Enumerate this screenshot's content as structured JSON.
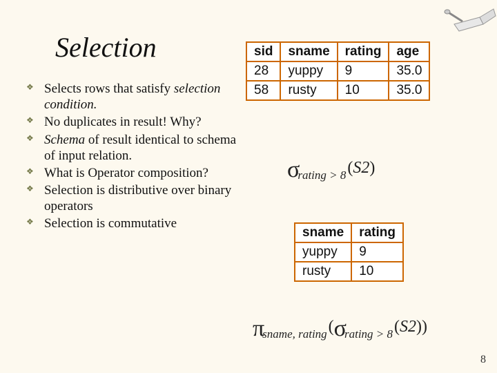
{
  "title": "Selection",
  "bullets": [
    {
      "pre": "Selects rows that satisfy ",
      "ital": "selection condition.",
      "post": ""
    },
    {
      "pre": "No duplicates in result! Why?",
      "ital": "",
      "post": ""
    },
    {
      "pre": "",
      "ital": "Schema",
      "post": " of result identical to schema of input relation."
    },
    {
      "pre": "What is Operator composition?",
      "ital": "",
      "post": ""
    },
    {
      "pre": "Selection is distributive over binary operators",
      "ital": "",
      "post": ""
    },
    {
      "pre": "Selection is commutative",
      "ital": "",
      "post": ""
    }
  ],
  "table1": {
    "headers": [
      "sid",
      "sname",
      "rating",
      "age"
    ],
    "rows": [
      [
        "28",
        "yuppy",
        "9",
        "35.0"
      ],
      [
        "58",
        "rusty",
        "10",
        "35.0"
      ]
    ]
  },
  "table2": {
    "headers": [
      "sname",
      "rating"
    ],
    "rows": [
      [
        "yuppy",
        "9"
      ],
      [
        "rusty",
        "10"
      ]
    ]
  },
  "formula1": {
    "predicate": "rating > 8",
    "arg": "S2"
  },
  "formula2": {
    "proj": "sname, rating",
    "predicate": "rating > 8",
    "arg": "S2"
  },
  "page": "8"
}
